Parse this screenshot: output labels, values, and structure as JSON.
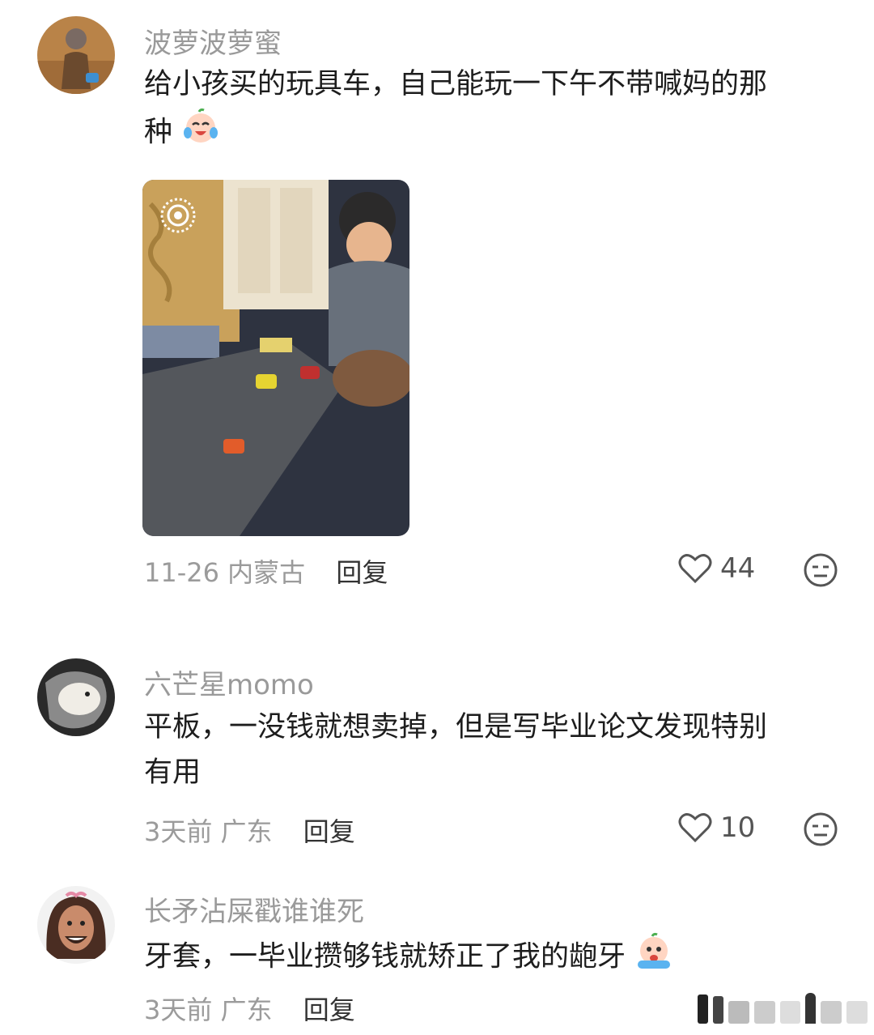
{
  "comments": [
    {
      "username": "波萝波萝蜜",
      "text_line1": "给小孩买的玩具车，自己能玩一下午不带喊妈的那",
      "text_line2": "种",
      "date": "11-26",
      "location": "内蒙古",
      "reply_label": "回复",
      "likes": "44"
    },
    {
      "username": "六芒星momo",
      "text_line1": "平板，一没钱就想卖掉，但是写毕业论文发现特别",
      "text_line2": "有用",
      "date": "3天前",
      "location": "广东",
      "reply_label": "回复",
      "likes": "10"
    },
    {
      "username": "长矛沾屎戳谁谁死",
      "text_line1": "牙套，一毕业攒够钱就矫正了我的龅牙",
      "date": "3天前",
      "location": "广东",
      "reply_label": "回复"
    }
  ],
  "icons": [
    "heart-outline-icon",
    "face-reaction-icon",
    "live-photo-icon",
    "crying-laughing-emoji",
    "crying-emoji"
  ]
}
